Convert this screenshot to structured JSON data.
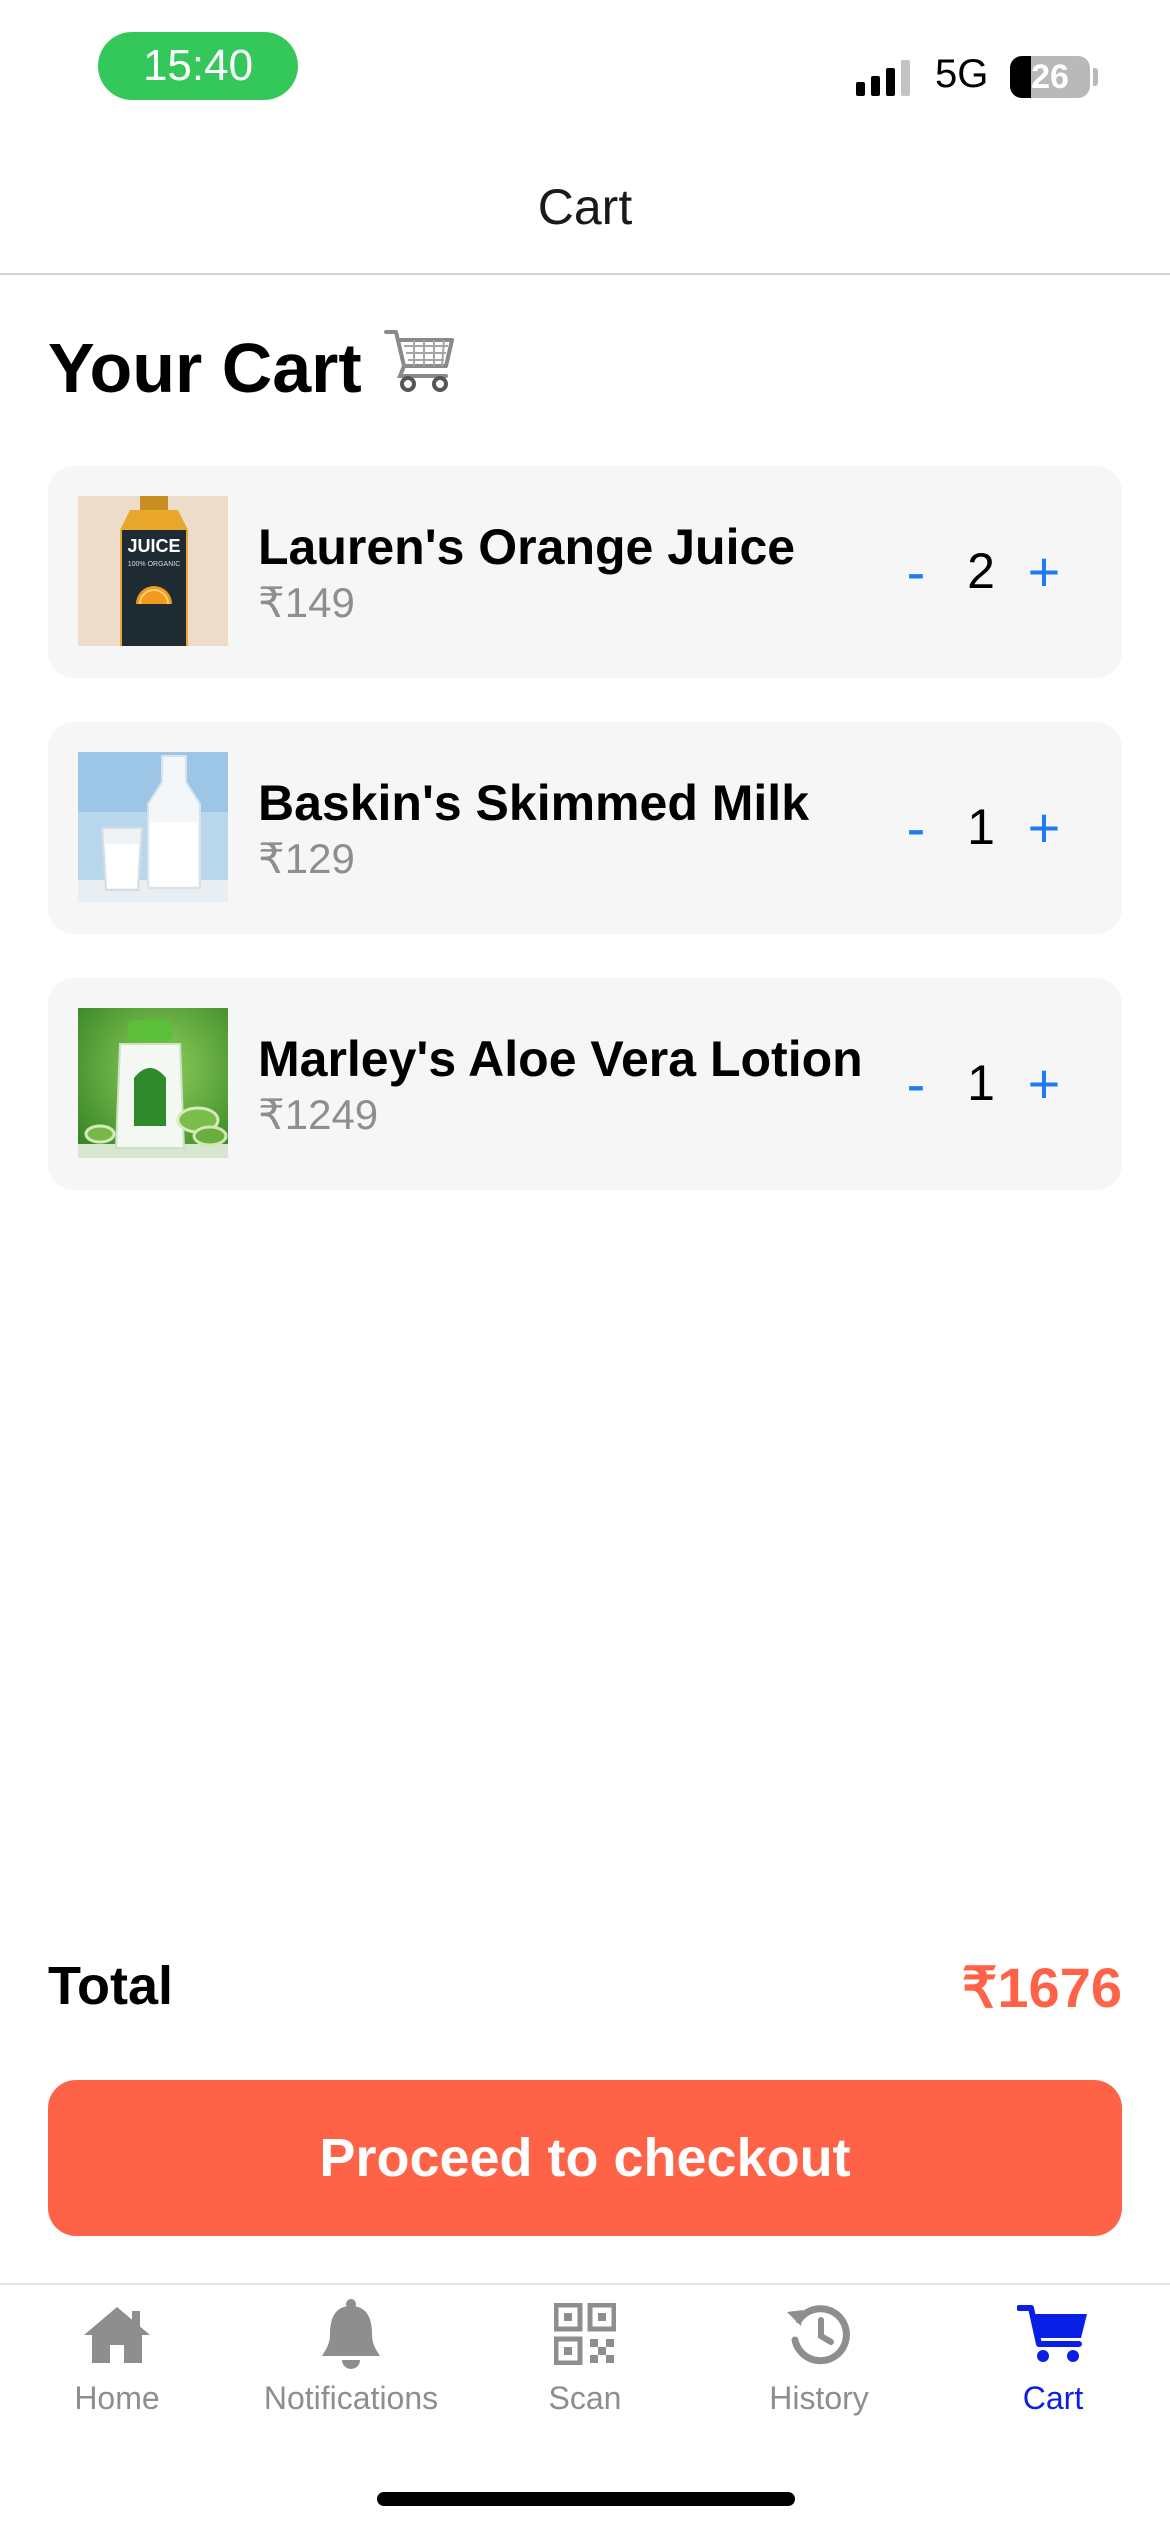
{
  "status_bar": {
    "time": "15:40",
    "network": "5G",
    "battery": "26",
    "battery_level": 0.26
  },
  "header": {
    "title": "Cart"
  },
  "page": {
    "title": "Your Cart",
    "title_emoji": "🛒"
  },
  "cart": {
    "items": [
      {
        "name": "Lauren's Orange Juice",
        "price": "₹149",
        "quantity": "2",
        "minus": "-",
        "plus": "+",
        "thumb_text": "JUICE",
        "thumb_subtext": "100% ORGANIC"
      },
      {
        "name": "Baskin's Skimmed Milk",
        "price": "₹129",
        "quantity": "1",
        "minus": "-",
        "plus": "+"
      },
      {
        "name": "Marley's Aloe Vera Lotion",
        "price": "₹1249",
        "quantity": "1",
        "minus": "-",
        "plus": "+"
      }
    ]
  },
  "summary": {
    "total_label": "Total",
    "total_value": "₹1676",
    "checkout_label": "Proceed to checkout"
  },
  "tabs": [
    {
      "label": "Home",
      "icon": "home-icon"
    },
    {
      "label": "Notifications",
      "icon": "bell-icon"
    },
    {
      "label": "Scan",
      "icon": "qr-code-icon"
    },
    {
      "label": "History",
      "icon": "history-icon"
    },
    {
      "label": "Cart",
      "icon": "cart-icon",
      "active": true
    }
  ],
  "colors": {
    "accent": "#ff6347",
    "link_blue": "#1e7cf2",
    "active_tab": "#0a1fe6",
    "time_pill": "#34c759",
    "muted": "#8e8e8e"
  }
}
